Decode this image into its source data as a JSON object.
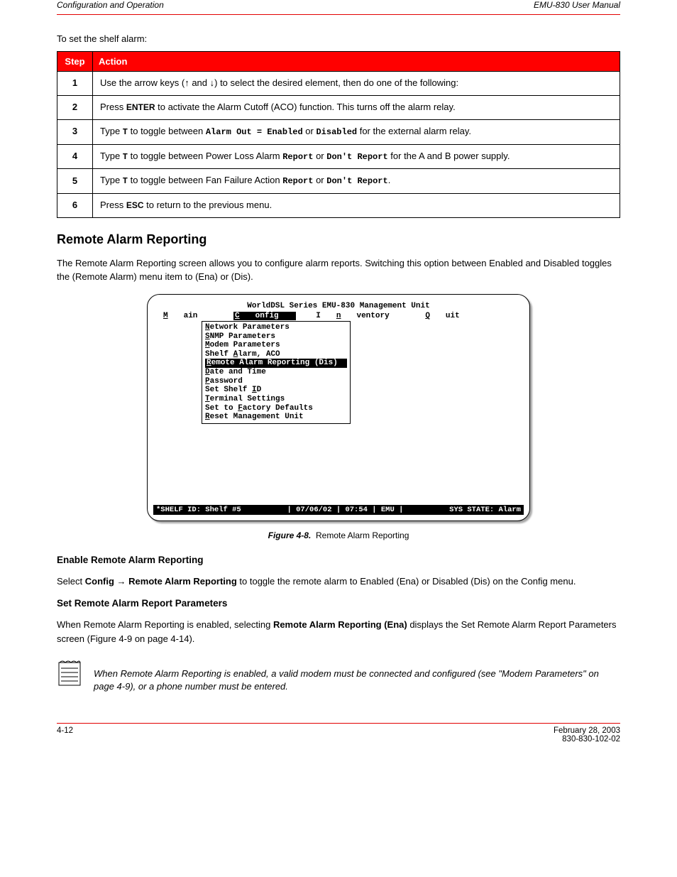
{
  "header": {
    "left": "Configuration and Operation",
    "right": "EMU-830 User Manual"
  },
  "intro": "To set the shelf alarm:",
  "table": {
    "headers": {
      "step": "Step",
      "action": "Action"
    },
    "rows": [
      {
        "num": "1",
        "pre": "Use the arrow keys (",
        "mid": " and ",
        "post": ") to select the desired element, then do one of the following:"
      },
      {
        "num": "2",
        "action_html": "Press <span class='small-caps'>ENTER</span> to activate the Alarm Cutoff (ACO) function. This turns off the alarm relay."
      },
      {
        "num": "3",
        "action_html": "Type <span class='mono'>T</span> to toggle between <span class='mono'>Alarm Out = Enabled</span> or <span class='mono'>Disabled</span> for the external alarm relay."
      },
      {
        "num": "4",
        "action_html": "Type <span class='mono'>T</span> to toggle between Power Loss Alarm <span class='mono'>Report</span> or <span class='mono'>Don't Report</span> for the A and B power supply."
      },
      {
        "num": "5",
        "action_html": "Type <span class='mono'>T</span> to toggle between Fan Failure Action <span class='mono'>Report</span> or <span class='mono'>Don't Report</span>."
      },
      {
        "num": "6",
        "action_html": "Press <span class='small-caps'>ESC</span> to return to the previous menu."
      }
    ]
  },
  "section": {
    "title": "Remote Alarm Reporting",
    "body": "The Remote Alarm Reporting screen allows you to configure alarm reports. Switching this option between Enabled and Disabled toggles the (Remote Alarm) menu item to (Ena) or (Dis).",
    "enable_title": "Enable Remote Alarm Reporting",
    "enable_line_pre": "Select ",
    "enable_path1": "Config",
    "enable_arrow": " → ",
    "enable_path2": "Remote Alarm Reporting",
    "enable_line_post": " to toggle the remote alarm to Enabled (Ena) or Disabled (Dis) on the Config menu."
  },
  "terminal": {
    "title": "WorldDSL Series EMU-830 Management Unit",
    "menus": {
      "main": "Main",
      "config": "Config",
      "inventory": "Inventory",
      "quit": "Quit"
    },
    "dropdown": [
      "Network Parameters",
      "SNMP Parameters",
      "Modem Parameters",
      "Shelf Alarm, ACO",
      "Remote Alarm Reporting (Dis)",
      "Date and Time",
      "Password",
      "Set Shelf ID",
      "Terminal Settings",
      "Set to Factory Defaults",
      "Reset Management Unit"
    ],
    "highlighted_index": 4,
    "status": {
      "shelf": "*SHELF ID: Shelf #5",
      "date": "07/06/02",
      "time": "07:54",
      "unit": "EMU",
      "state": "SYS STATE: Alarm"
    }
  },
  "figure": {
    "num": "Figure 4-8.",
    "caption": "Remote Alarm Reporting"
  },
  "subsection": {
    "title": "Set Remote Alarm Report Parameters",
    "body_pre": "When Remote Alarm Reporting is enabled, selecting ",
    "path": "Remote Alarm Reporting (Ena)",
    "body_post": " displays the Set Remote Alarm Report Parameters screen (Figure 4-9 on page 4-14)."
  },
  "note": "When Remote Alarm Reporting is enabled, a valid modem must be connected and configured (see \"Modem Parameters\" on page 4-9), or a phone number must be entered.",
  "footer": {
    "left": "4-12",
    "right": "February 28, 2003",
    "rev": "830-830-102-02"
  }
}
